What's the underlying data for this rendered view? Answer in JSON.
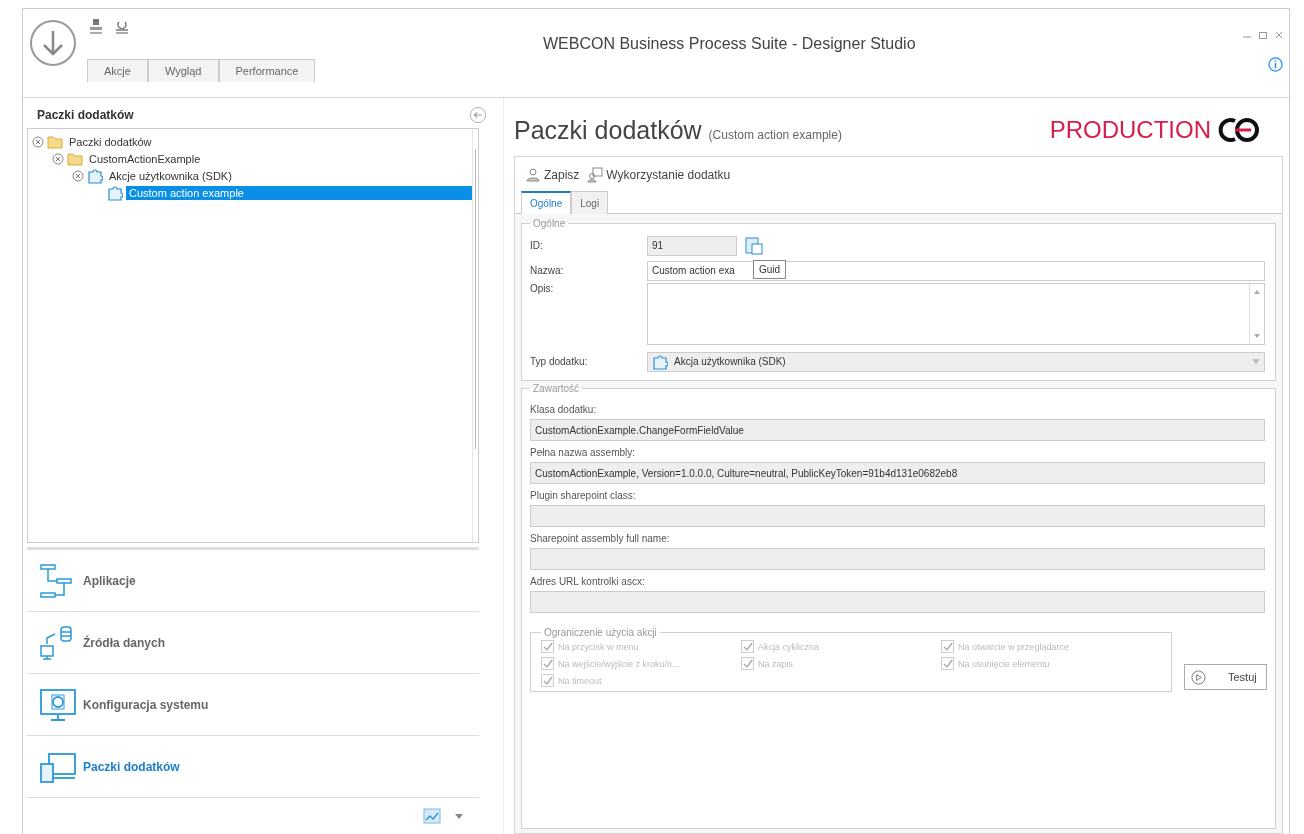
{
  "window": {
    "title": "WEBCON Business Process Suite - Designer Studio"
  },
  "ribbon": {
    "tabs": [
      {
        "label": "Akcje",
        "selected": false
      },
      {
        "label": "Wygląd",
        "selected": false
      },
      {
        "label": "Performance",
        "selected": false
      }
    ]
  },
  "sidebar": {
    "title": "Paczki dodatków",
    "tree": [
      {
        "label": "Paczki dodatków",
        "kind": "folder",
        "expanded": true,
        "selected": false,
        "children": [
          {
            "label": "CustomActionExample",
            "kind": "folder",
            "expanded": true,
            "selected": false,
            "children": [
              {
                "label": "Akcje użytkownika (SDK)",
                "kind": "puzzle",
                "expanded": true,
                "selected": false,
                "children": [
                  {
                    "label": "Custom action example",
                    "kind": "puzzle",
                    "selected": true
                  }
                ]
              }
            ]
          }
        ]
      }
    ],
    "nav": [
      {
        "label": "Aplikacje",
        "kind": "apps",
        "selected": false
      },
      {
        "label": "Źródła danych",
        "kind": "data",
        "selected": false
      },
      {
        "label": "Konfiguracja systemu",
        "kind": "config",
        "selected": false
      },
      {
        "label": "Paczki dodatków",
        "kind": "packs",
        "selected": true
      }
    ]
  },
  "main": {
    "title": "Paczki dodatków",
    "subtitle": "(Custom action example)",
    "logo": "PRODUCTION",
    "toolbar": [
      "Zapisz",
      "Wykorzystanie dodatku"
    ],
    "tabs": [
      {
        "label": "Ogólne",
        "selected": true
      },
      {
        "label": "Logi",
        "selected": false
      }
    ],
    "general": {
      "legend": "Ogólne",
      "fields": [
        {
          "kind": "id",
          "label": "ID:",
          "value": "91",
          "tooltip": "Guid"
        },
        {
          "kind": "text",
          "label": "Nazwa:",
          "value": "Custom action exa"
        },
        {
          "kind": "textarea",
          "label": "Opis:"
        },
        {
          "kind": "select",
          "label": "Typ dodatku:",
          "value": "Akcja użytkownika (SDK)"
        }
      ]
    },
    "content": {
      "legend": "Zawartość",
      "fields": [
        {
          "label": "Klasa dodatku:",
          "value": "CustomActionExample.ChangeFormFieldValue"
        },
        {
          "label": "Pełna nazwa assembly:",
          "value": "CustomActionExample, Version=1.0.0.0, Culture=neutral, PublicKeyToken=91b4d131e0682eb8"
        },
        {
          "label": "Plugin sharepoint class:"
        },
        {
          "label": "Sharepoint assembly full name:"
        },
        {
          "label": "Adres URL kontrolki ascx:"
        }
      ]
    },
    "restrictions": {
      "legend": "Ograniczenie użycia akcji",
      "options": [
        {
          "label": "Na przycisk w menu",
          "checked": true,
          "disabled": true
        },
        {
          "label": "Akcja cykliczna",
          "checked": true,
          "disabled": true
        },
        {
          "label": "Na otwarcie w przeglądarce",
          "checked": true,
          "disabled": true
        },
        {
          "label": "Na wejście/wyjście z kroku/n...",
          "checked": true,
          "disabled": true
        },
        {
          "label": "Na zapis",
          "checked": true,
          "disabled": true
        },
        {
          "label": "Na usunięcie elementu",
          "checked": true,
          "disabled": true
        },
        {
          "label": "Na timeout",
          "checked": true,
          "disabled": true
        }
      ]
    },
    "test_button": "Testuj"
  }
}
